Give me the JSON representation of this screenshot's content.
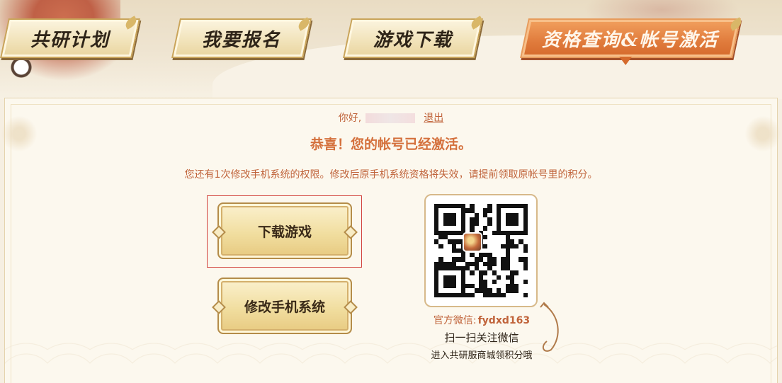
{
  "tabs": [
    {
      "label": "共研计划",
      "active": false
    },
    {
      "label": "我要报名",
      "active": false
    },
    {
      "label": "游戏下载",
      "active": false
    },
    {
      "label": "资格查询&帐号激活",
      "active": true
    }
  ],
  "account": {
    "greeting": "你好,",
    "logout_label": "退出",
    "congrats": "恭喜！您的帐号已经激活。",
    "notice": "您还有1次修改手机系统的权限。修改后原手机系统资格将失效，请提前领取原帐号里的积分。"
  },
  "buttons": {
    "download_label": "下载游戏",
    "modify_label": "修改手机系统"
  },
  "qrcode": {
    "wechat_prefix": "官方微信:",
    "wechat_id": "fydxd163",
    "scan_label": "扫一扫关注微信",
    "enter_label": "进入共研服商城领积分哦"
  },
  "colors": {
    "accent": "#d4703c",
    "text_orange": "#c0633a",
    "button_gold": "#f1dea0",
    "active_tab": "#e07b3c"
  }
}
